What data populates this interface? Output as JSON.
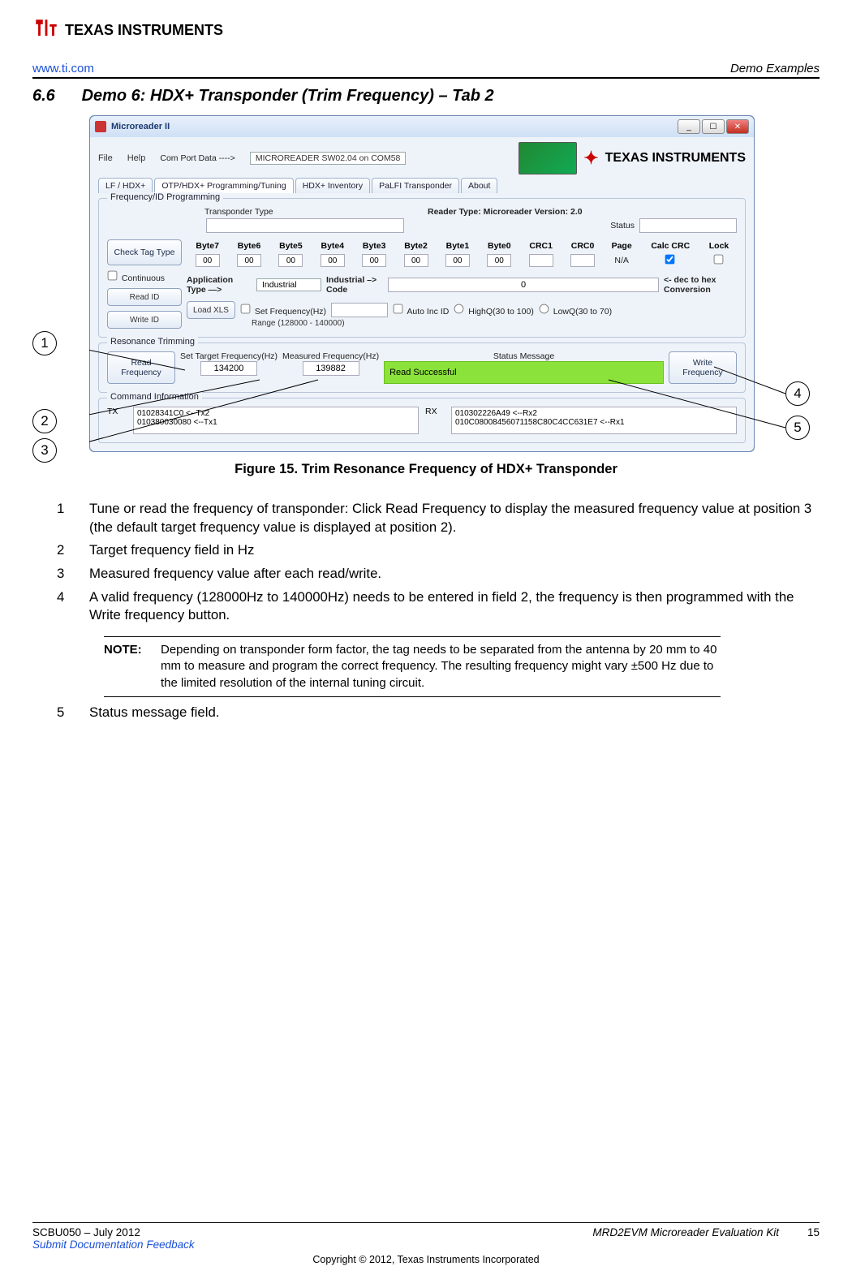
{
  "header": {
    "logo_text": "TEXAS INSTRUMENTS",
    "url": "www.ti.com",
    "breadcrumb": "Demo Examples"
  },
  "section": {
    "number": "6.6",
    "title": "Demo 6: HDX+ Transponder (Trim Frequency) – Tab 2"
  },
  "app": {
    "window_title": "Microreader II",
    "menu": {
      "file": "File",
      "help": "Help",
      "com_label": "Com Port Data ---->",
      "com_value": "MICROREADER SW02.04 on COM58"
    },
    "brand": "TEXAS INSTRUMENTS",
    "tabs": [
      "LF / HDX+",
      "OTP/HDX+ Programming/Tuning",
      "HDX+ Inventory",
      "PaLFI Transponder",
      "About"
    ],
    "active_tab_index": 1,
    "freq_group": {
      "title": "Frequency/ID Programming",
      "reader_info": "Reader Type: Microreader   Version: 2.0",
      "transponder_label": "Transponder Type",
      "status_label": "Status",
      "buttons": {
        "check_tag": "Check Tag Type",
        "continuous": "Continuous",
        "read_id": "Read ID",
        "write_id": "Write ID",
        "load_xls": "Load XLS"
      },
      "byte_headers": [
        "Byte7",
        "Byte6",
        "Byte5",
        "Byte4",
        "Byte3",
        "Byte2",
        "Byte1",
        "Byte0",
        "CRC1",
        "CRC0",
        "Page",
        "Calc CRC",
        "Lock"
      ],
      "byte_values": [
        "00",
        "00",
        "00",
        "00",
        "00",
        "00",
        "00",
        "00",
        "",
        "",
        "N/A"
      ],
      "calc_crc_checked": true,
      "lock_checked": false,
      "app_type_label": "Application Type   —>",
      "app_type_value": "Industrial",
      "ind_code_label": "Industrial –> Code",
      "ind_code_value": "0",
      "dec_hex": "<- dec to hex Conversion",
      "set_freq_label": "Set Frequency(Hz)",
      "set_freq_range": "Range (128000 - 140000)",
      "auto_inc": "Auto Inc ID",
      "highq": "HighQ(30 to 100)",
      "lowq": "LowQ(30 to 70)"
    },
    "res_group": {
      "title": "Resonance Trimming",
      "read_btn": "Read Frequency",
      "write_btn": "Write Frequency",
      "set_target_label": "Set Target Frequency(Hz)",
      "measured_label": "Measured Frequency(Hz)",
      "status_label": "Status Message",
      "target_value": "134200",
      "measured_value": "139882",
      "status_value": "Read Successful"
    },
    "cmd_group": {
      "title": "Command Information",
      "tx_label": "TX",
      "rx_label": "RX",
      "tx_lines": "01028341C0  <--Tx2\n010380030080  <--Tx1",
      "rx_lines": "010302226A49  <--Rx2\n010C08008456071158C80C4CC631E7  <--Rx1"
    }
  },
  "figure_caption": "Figure 15. Trim Resonance Frequency of HDX+ Transponder",
  "callouts": [
    "1",
    "2",
    "3",
    "4",
    "5"
  ],
  "list": [
    {
      "n": "1",
      "t": "Tune or read the frequency of transponder: Click Read Frequency to display the measured frequency value at position 3 (the default target frequency value is displayed at position 2)."
    },
    {
      "n": "2",
      "t": "Target frequency field in Hz"
    },
    {
      "n": "3",
      "t": "Measured frequency value after each read/write."
    },
    {
      "n": "4",
      "t": "A valid frequency (128000Hz to 140000Hz) needs to be entered in field 2, the frequency is then programmed with the Write frequency button."
    }
  ],
  "note": {
    "label": "NOTE:",
    "text": "Depending on transponder form factor, the tag needs to be separated from the antenna by 20 mm to 40 mm to measure and program the correct frequency. The resulting frequency might vary ±500 Hz due to the limited resolution of the internal tuning circuit."
  },
  "list_after": [
    {
      "n": "5",
      "t": "Status message field."
    }
  ],
  "footer": {
    "doc_id": "SCBU050 – July 2012",
    "feedback": "Submit Documentation Feedback",
    "doc_title": "MRD2EVM Microreader Evaluation Kit",
    "page": "15",
    "copyright": "Copyright © 2012, Texas Instruments Incorporated"
  }
}
